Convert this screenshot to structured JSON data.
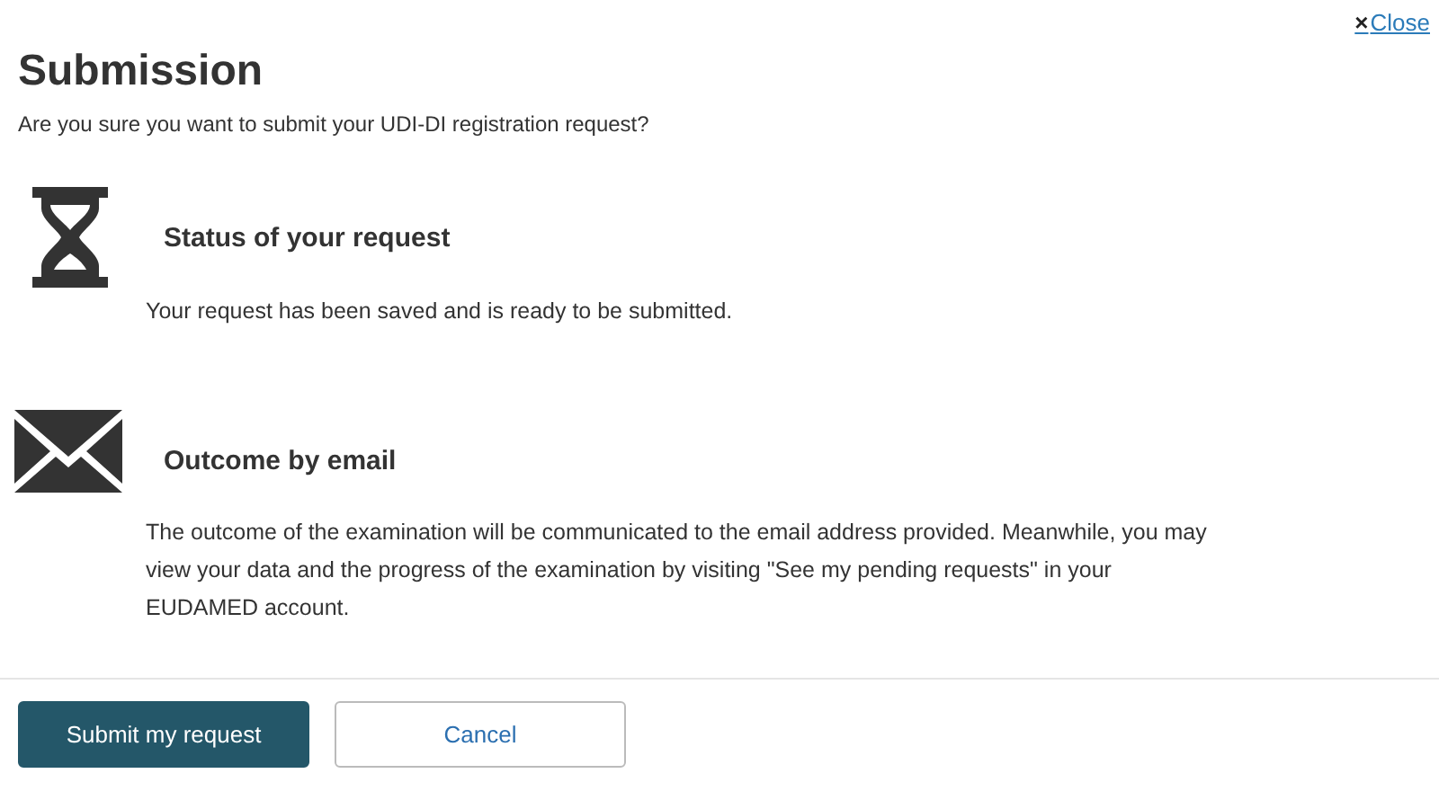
{
  "close_link": {
    "icon": "×",
    "label": "Close"
  },
  "title": "Submission",
  "subtitle": "Are you sure you want to submit your UDI-DI registration request?",
  "sections": [
    {
      "kind": "hourglass",
      "heading": "Status of your request",
      "text": "Your request has been saved and is ready to be submitted."
    },
    {
      "kind": "envelope",
      "heading": "Outcome by email",
      "text": "The outcome of the examination will be communicated to the email address provided. Meanwhile, you may view your data and the progress of the examination by visiting \"See my pending requests\" in your EUDAMED account."
    }
  ],
  "buttons": [
    {
      "kind": "primary",
      "label": "Submit my request"
    },
    {
      "kind": "secondary",
      "label": "Cancel"
    }
  ]
}
